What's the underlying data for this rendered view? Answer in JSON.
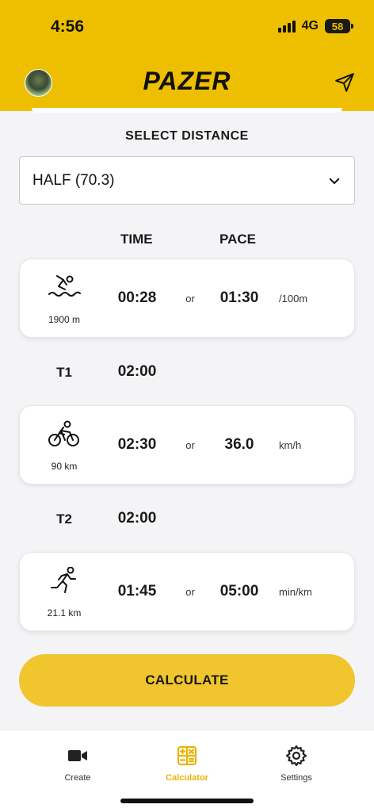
{
  "status_bar": {
    "time": "4:56",
    "network": "4G",
    "battery": "58"
  },
  "header": {
    "logo_text": "PAZER"
  },
  "distance": {
    "label": "SELECT DISTANCE",
    "selected": "HALF (70.3)"
  },
  "columns": {
    "time": "TIME",
    "pace": "PACE"
  },
  "legs": {
    "swim": {
      "distance": "1900 m",
      "time": "00:28",
      "or": "or",
      "pace": "01:30",
      "unit": "/100m"
    },
    "bike": {
      "distance": "90 km",
      "time": "02:30",
      "or": "or",
      "pace": "36.0",
      "unit": "km/h"
    },
    "run": {
      "distance": "21.1 km",
      "time": "01:45",
      "or": "or",
      "pace": "05:00",
      "unit": "min/km"
    }
  },
  "transitions": {
    "t1": {
      "label": "T1",
      "time": "02:00"
    },
    "t2": {
      "label": "T2",
      "time": "02:00"
    }
  },
  "calculate_label": "CALCULATE",
  "tabs": [
    {
      "label": "Create",
      "icon": "video-camera-icon"
    },
    {
      "label": "Calculator",
      "icon": "calculator-icon"
    },
    {
      "label": "Settings",
      "icon": "gear-icon"
    }
  ],
  "colors": {
    "brand": "#eebf00",
    "button": "#f0c52e",
    "active_tab": "#e8b400"
  }
}
